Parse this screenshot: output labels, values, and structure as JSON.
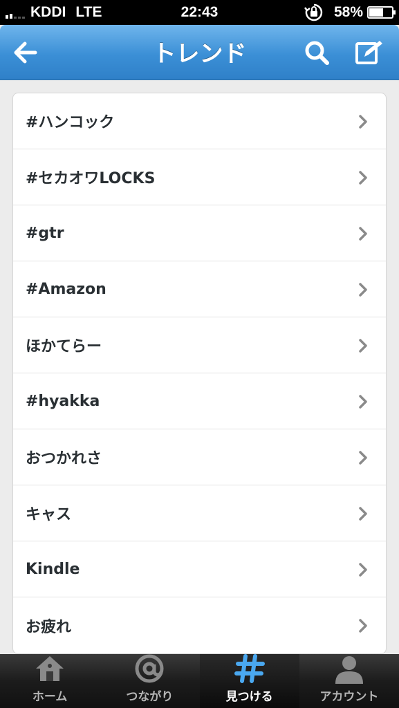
{
  "status_bar": {
    "carrier": "KDDI",
    "network": "LTE",
    "time": "22:43",
    "battery_percent": "58%",
    "battery_level": 0.58
  },
  "nav": {
    "title": "トレンド",
    "back_icon": "back-arrow-icon",
    "search_icon": "search-icon",
    "compose_icon": "compose-icon"
  },
  "trends": [
    {
      "label": "#ハンコック"
    },
    {
      "label": "#セカオワLOCKS"
    },
    {
      "label": "#gtr"
    },
    {
      "label": "#Amazon"
    },
    {
      "label": "ほかてらー"
    },
    {
      "label": "#hyakka"
    },
    {
      "label": "おつかれさ"
    },
    {
      "label": "キャス"
    },
    {
      "label": "Kindle"
    },
    {
      "label": "お疲れ"
    }
  ],
  "tabs": [
    {
      "label": "ホーム",
      "icon": "home-icon",
      "active": false
    },
    {
      "label": "つながり",
      "icon": "at-icon",
      "active": false
    },
    {
      "label": "見つける",
      "icon": "hashtag-icon",
      "active": true
    },
    {
      "label": "アカウント",
      "icon": "person-icon",
      "active": false
    }
  ],
  "colors": {
    "nav_blue": "#3b8fd6",
    "active_tab_icon": "#4aa8f0"
  }
}
